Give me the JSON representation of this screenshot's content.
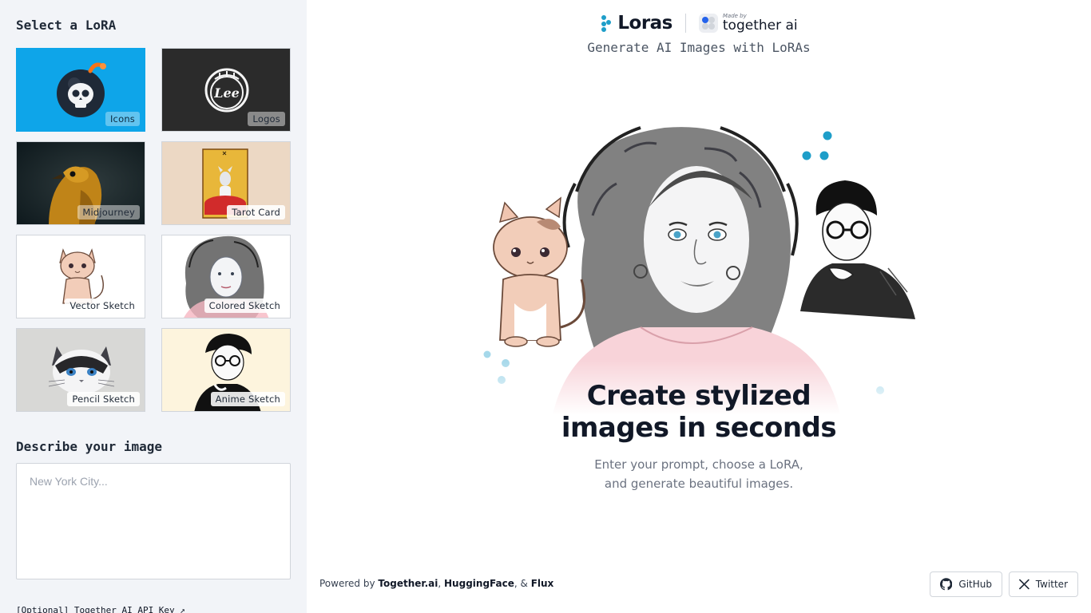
{
  "sidebar": {
    "select_title": "Select a LoRA",
    "loras": [
      {
        "label": "Icons",
        "selected": true
      },
      {
        "label": "Logos",
        "selected": false
      },
      {
        "label": "Midjourney",
        "selected": false
      },
      {
        "label": "Tarot Card",
        "selected": false
      },
      {
        "label": "Vector Sketch",
        "selected": false
      },
      {
        "label": "Colored Sketch",
        "selected": false
      },
      {
        "label": "Pencil Sketch",
        "selected": false
      },
      {
        "label": "Anime Sketch",
        "selected": false
      }
    ],
    "logo_thumb_text": "Lee",
    "describe_title": "Describe your image",
    "prompt_placeholder": "New York City...",
    "prompt_value": "",
    "api_key_link": "[Optional] Together AI API Key ↗"
  },
  "header": {
    "logo_text": "Loras",
    "made_by_small": "Made by",
    "made_by_name": "together ai",
    "tagline": "Generate AI Images with LoRAs"
  },
  "hero": {
    "headline_line1": "Create stylized",
    "headline_line2": "images in seconds",
    "sub_line1": "Enter your prompt, choose a LoRA,",
    "sub_line2": "and generate beautiful images."
  },
  "footer": {
    "powered_by": "Powered by",
    "together": "Together.ai",
    "comma": ",",
    "huggingface": "HuggingFace",
    "amp": ", &",
    "flux": "Flux",
    "github_label": "GitHub",
    "twitter_label": "Twitter"
  },
  "colors": {
    "sidebar_bg": "#f2f4f8",
    "accent": "#1e9ec9",
    "icons_bg": "#0ea5e9",
    "text": "#111827"
  }
}
